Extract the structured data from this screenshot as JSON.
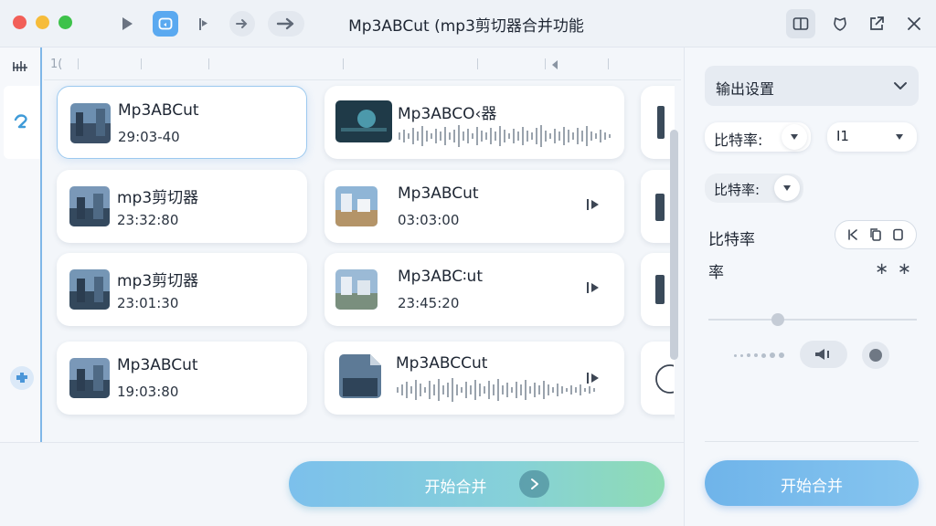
{
  "app": {
    "title": "Mp3ABCut (mp3剪切器合并功能"
  },
  "ruler": {
    "label": "1("
  },
  "tracks": [
    {
      "name": "Mp3ABCut",
      "time": "29:03-40",
      "selected": true
    },
    {
      "name": "Mp3ABCO‹器",
      "time": ""
    },
    {
      "name": "mp3剪切器",
      "time": "23:32:80"
    },
    {
      "name": "Mp3ABCut",
      "time": "03:03:00"
    },
    {
      "name": "mp3剪切器",
      "time": "23:01:30"
    },
    {
      "name": "Mp3ABC∶ut",
      "time": "23:45:20"
    },
    {
      "name": "Mp3ABCut",
      "time": "19:03:80"
    },
    {
      "name": "Mp3ABCCut",
      "time": ""
    }
  ],
  "merge_main": {
    "label": "开始合并"
  },
  "panel": {
    "output_settings": "输出设置",
    "bitrate_label_1": "比特率:",
    "bitrate_value": "I1",
    "bitrate_label_2": "比特率:",
    "bitrate_label_3": "比特率",
    "rate_label": "率",
    "rate_symbols": "∗ ∗",
    "merge_label": "开始合并"
  },
  "colors": {
    "accent": "#6fb4ea",
    "selected_border": "#9cc9ef",
    "close_red": "#f25f58",
    "minimize_yellow": "#f6bc3a",
    "zoom_green": "#3dc24a",
    "active_tool": "#5aa9f0"
  },
  "icons": {
    "play": "play-icon",
    "loop": "loop-icon",
    "mark_in": "mark-in-icon",
    "forward": "forward-arrow-icon",
    "next": "next-arrow-icon",
    "split_view": "split-view-icon",
    "undo_shield": "shield-icon",
    "export": "export-icon",
    "close": "close-icon"
  }
}
